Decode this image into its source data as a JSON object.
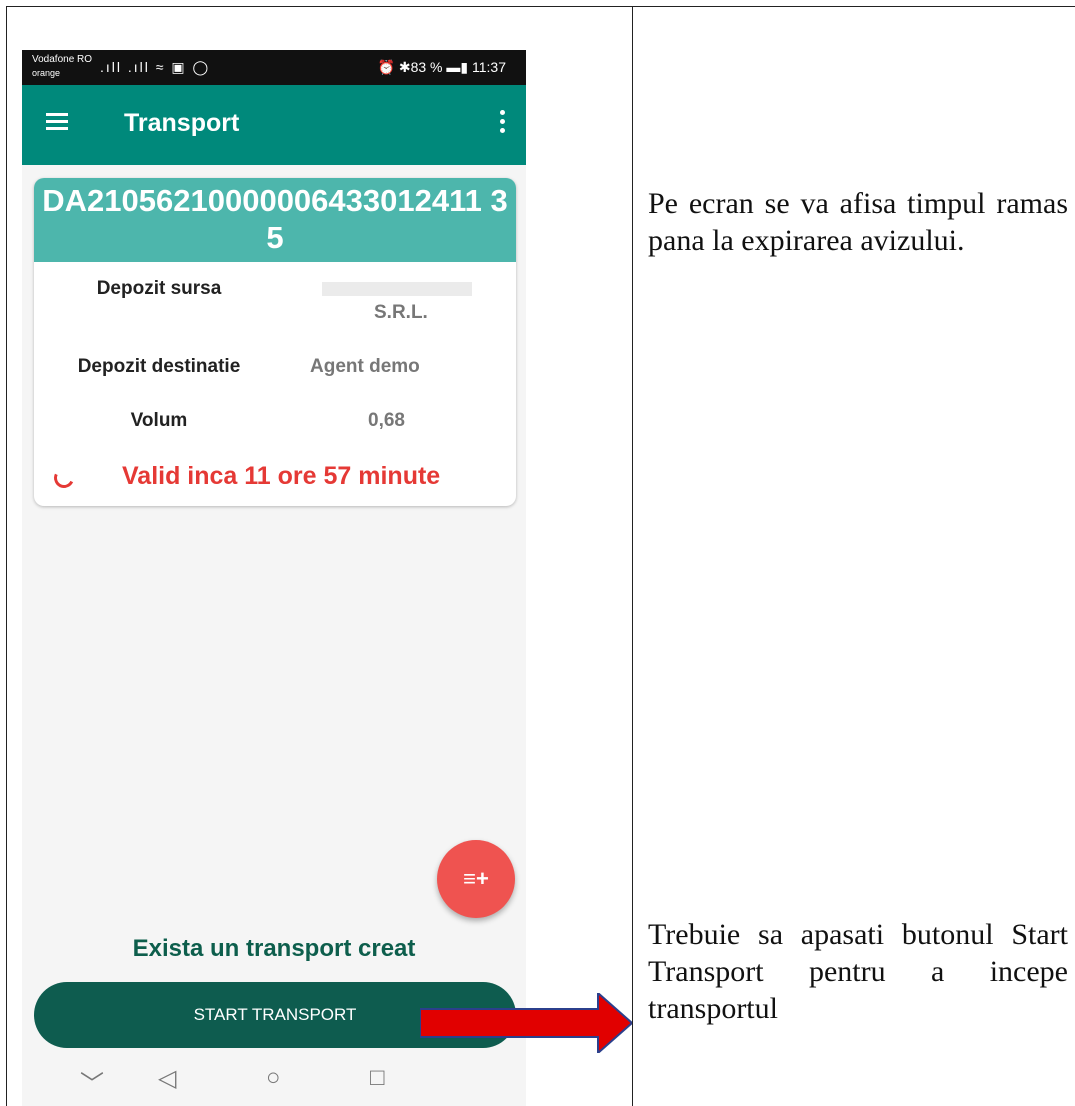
{
  "statusbar": {
    "carrier1": "Vodafone RO",
    "carrier2": "orange",
    "icons": ".ıll .ıll ≈ ▣ ◯",
    "right": "⏰ ✱83 % ▬▮ 11:37"
  },
  "appbar": {
    "title": "Transport"
  },
  "card": {
    "header": "DA21056210000006433012411 35",
    "rows": [
      {
        "label": "Depozit sursa",
        "value": "S.R.L."
      },
      {
        "label": "Depozit destinatie",
        "value": "Agent demo"
      },
      {
        "label": "Volum",
        "value": "0,68"
      }
    ],
    "valid": "Valid inca 11 ore 57 minute"
  },
  "fab": {
    "symbol": "≡+"
  },
  "exists": "Exista un transport creat",
  "start_button": "START TRANSPORT",
  "navbar": {
    "down": "﹀",
    "back": "◁",
    "home": "○",
    "recent": "□"
  },
  "instructions": {
    "top": "Pe ecran se va afisa timpul ramas pana la expirarea avizului.",
    "bottom": "Trebuie sa apasati butonul Start Transport pentru a incepe transportul"
  },
  "colors": {
    "appbar": "#00897b",
    "card_header": "#4db6ac",
    "accent_red": "#e53935",
    "button": "#0e5c4f",
    "arrow": "#e10000"
  }
}
